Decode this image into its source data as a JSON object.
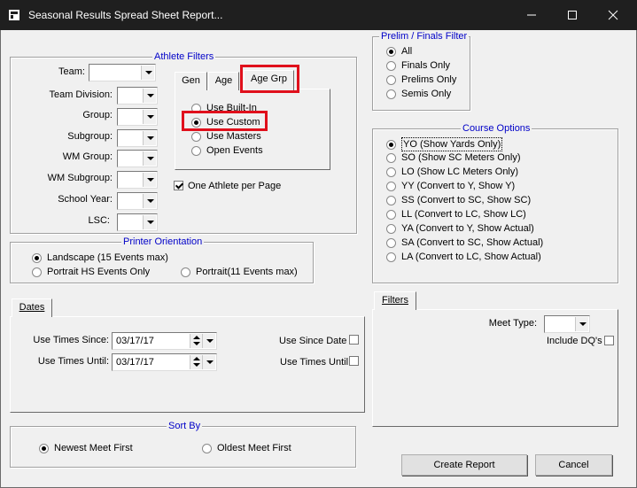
{
  "window": {
    "title": "Seasonal Results Spread Sheet Report..."
  },
  "athlete_filters": {
    "legend": "Athlete Filters",
    "fields": [
      {
        "label": "Team:",
        "value": ""
      },
      {
        "label": "Team Division:",
        "value": ""
      },
      {
        "label": "Group:",
        "value": ""
      },
      {
        "label": "Subgroup:",
        "value": ""
      },
      {
        "label": "WM Group:",
        "value": ""
      },
      {
        "label": "WM Subgroup:",
        "value": ""
      },
      {
        "label": "School Year:",
        "value": ""
      },
      {
        "label": "LSC:",
        "value": ""
      }
    ],
    "tabs": [
      "Gen",
      "Age",
      "Age Grp"
    ],
    "age_options": [
      "Use Built-In",
      "Use Custom",
      "Use Masters",
      "Open Events"
    ],
    "age_selected": "Use Custom",
    "one_athlete_label": "One Athlete per Page",
    "one_athlete_checked": true
  },
  "prelim_filter": {
    "legend": "Prelim / Finals Filter",
    "options": [
      "All",
      "Finals Only",
      "Prelims Only",
      "Semis Only"
    ],
    "selected": "All"
  },
  "course_options": {
    "legend": "Course Options",
    "options": [
      "YO (Show Yards Only)",
      "SO (Show SC Meters Only)",
      "LO (Show LC Meters Only)",
      "YY (Convert to Y, Show Y)",
      "SS (Convert to SC, Show SC)",
      "LL (Convert to LC, Show LC)",
      "YA (Convert to Y, Show Actual)",
      "SA (Convert to SC, Show Actual)",
      "LA (Convert to LC, Show Actual)"
    ],
    "selected": "YO (Show Yards Only)"
  },
  "printer_orientation": {
    "legend": "Printer Orientation",
    "landscape": "Landscape (15 Events max)",
    "portrait_hs": "Portrait HS Events Only",
    "portrait": "Portrait(11 Events max)",
    "selected": "landscape"
  },
  "dates": {
    "tab": "Dates",
    "since_label": "Use Times Since:",
    "since_value": "03/17/17",
    "until_label": "Use Times Until:",
    "until_value": "03/17/17",
    "use_since_label": "Use Since Date",
    "use_until_label": "Use Times Until"
  },
  "filters": {
    "tab": "Filters",
    "meet_type_label": "Meet Type:",
    "meet_type_value": "",
    "include_dq_label": "Include DQ's"
  },
  "sort_by": {
    "legend": "Sort By",
    "newest": "Newest Meet First",
    "oldest": "Oldest Meet First",
    "selected": "newest"
  },
  "buttons": {
    "create": "Create Report",
    "cancel": "Cancel"
  },
  "colors": {
    "legend": "#0000c8",
    "highlight": "#e0101c",
    "titlebar": "#1f1f1f"
  }
}
